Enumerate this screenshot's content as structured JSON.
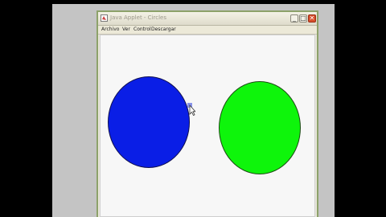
{
  "window": {
    "title": "Java Applet - Circles",
    "controls": {
      "minimize": "_",
      "maximize": "□",
      "close": "✕"
    },
    "app_icon": "java-icon"
  },
  "menu": {
    "items": [
      "Archivo",
      "Ver",
      "Control",
      "Descargar"
    ]
  },
  "canvas": {
    "shapes": [
      {
        "type": "circle",
        "color": "#0a1ee6",
        "outline": "#101050"
      },
      {
        "type": "circle",
        "color": "#0ef50b",
        "outline": "#1c4a14"
      }
    ]
  },
  "cursor": {
    "icon": "selection-cursor-icon"
  }
}
